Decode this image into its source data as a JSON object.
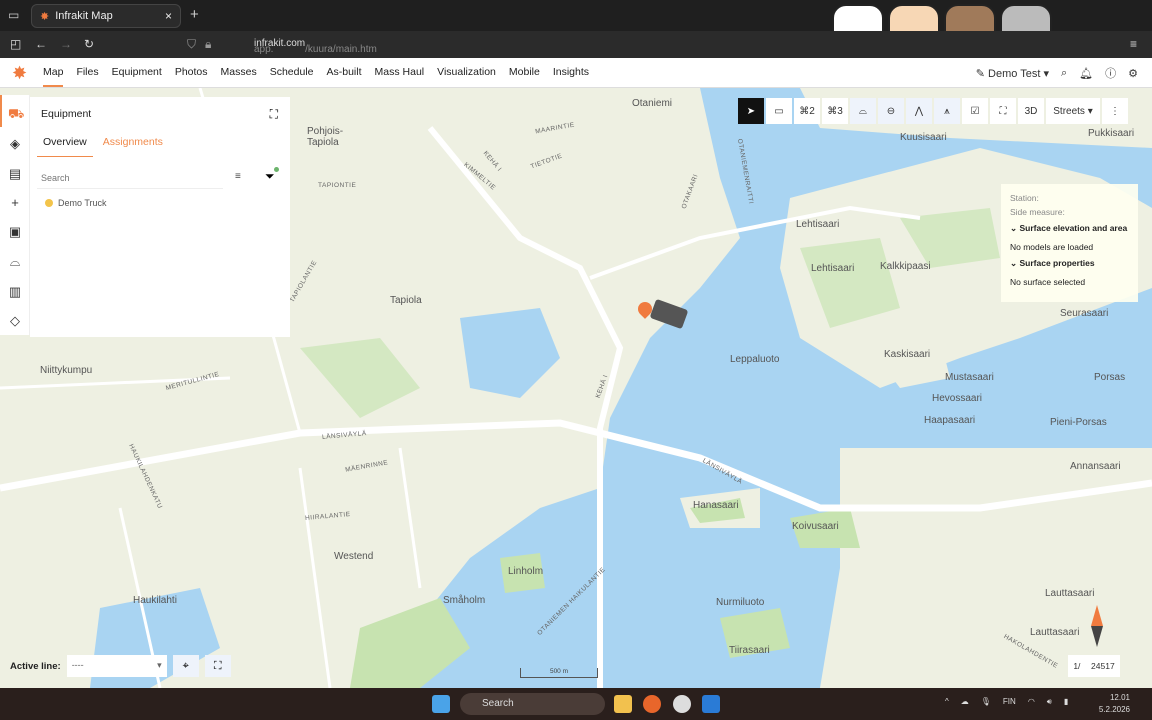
{
  "browser": {
    "tab_title": "Infrakit Map",
    "url_prefix": "app.",
    "url_domain": "infrakit.com",
    "url_path": "/kuura/main.htm"
  },
  "app": {
    "menu": [
      "Map",
      "Files",
      "Equipment",
      "Photos",
      "Masses",
      "Schedule",
      "As-built",
      "Mass Haul",
      "Visualization",
      "Mobile",
      "Insights"
    ],
    "active_menu": "Map",
    "user": "Demo Test",
    "accent": "#f08a4b"
  },
  "panel": {
    "title": "Equipment",
    "tabs": [
      "Overview",
      "Assignments"
    ],
    "search_placeholder": "Search",
    "items": [
      {
        "label": "Demo Truck",
        "status_color": "#f3c44a"
      }
    ]
  },
  "toolbar": {
    "polygon2": "2",
    "polygon3": "3",
    "mode3d": "3D",
    "basemap": "Streets"
  },
  "info": {
    "station": "Station:",
    "side": "Side measure:",
    "section1": "Surface elevation and area",
    "section1_text": "No models are loaded",
    "section2": "Surface properties",
    "section2_text": "No surface selected"
  },
  "map": {
    "places": [
      "Otaniemi",
      "Pohjois-Tapiola",
      "Tapiola",
      "Niittykumpu",
      "Westend",
      "Haukilahti",
      "Lehtisaari",
      "Lehtisaari",
      "Kalkkipaasi",
      "Kuusisaari",
      "Pukkisaari",
      "Leppaluoto",
      "Kaskisaari",
      "Mustasaari",
      "Hevossaari",
      "Haapasaari",
      "Pieni-Porsas",
      "Porsas",
      "Annansaari",
      "Hanasaari",
      "Koivusaari",
      "Linholm",
      "Småholm",
      "Nurmiluoto",
      "Tiirasaari",
      "Lauttasaari",
      "Lauttasaari",
      "Seurasaari"
    ],
    "roads": [
      "MAARINTIE",
      "KEHÄ I",
      "KIMMELTIE",
      "TIETOTIE",
      "TAPIONTIE",
      "OTAKAARI",
      "OTANIEMENRAITTI",
      "TAPIOLANTIE",
      "MERITULLINTIE",
      "LÄNSIVÄYLÄ",
      "LÄNSIVÄYLÄ",
      "MÄENRINNE",
      "HIIRALANTIE",
      "HAUKILAHDENKATU",
      "OTANIEMEN HAIKULANTIE",
      "KEHÄ I",
      "HAKOLAHDENTIE"
    ],
    "scale": "500 m"
  },
  "bottom": {
    "active_line_label": "Active line:",
    "active_line_value": "----",
    "page_current": "1/",
    "page_total": "24517"
  },
  "taskbar": {
    "search": "Search",
    "lang": "FIN",
    "time": "12.01",
    "date": "5.2.2026"
  }
}
